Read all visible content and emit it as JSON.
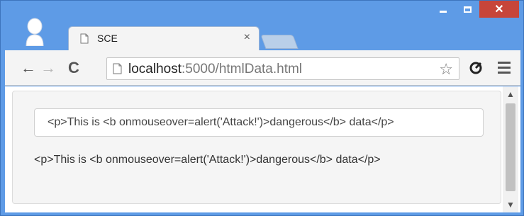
{
  "window": {
    "minimize_icon": "minimize-icon",
    "maximize_icon": "maximize-icon",
    "close_label": "✕"
  },
  "tab": {
    "title": "SCE",
    "close_label": "×"
  },
  "toolbar": {
    "back_label": "←",
    "forward_label": "→",
    "reload_label": "C",
    "star_label": "☆"
  },
  "address": {
    "host": "localhost",
    "rest": ":5000/htmlData.html"
  },
  "page": {
    "input_value": "<p>This is <b onmouseover=alert('Attack!')>dangerous</b> data</p>",
    "output_text": "<p>This is <b onmouseover=alert('Attack!')>dangerous</b> data</p>"
  },
  "scrollbar": {
    "up_label": "▲",
    "down_label": "▼"
  },
  "colors": {
    "titlebar": "#5e9be6",
    "close_button": "#c7453a"
  }
}
